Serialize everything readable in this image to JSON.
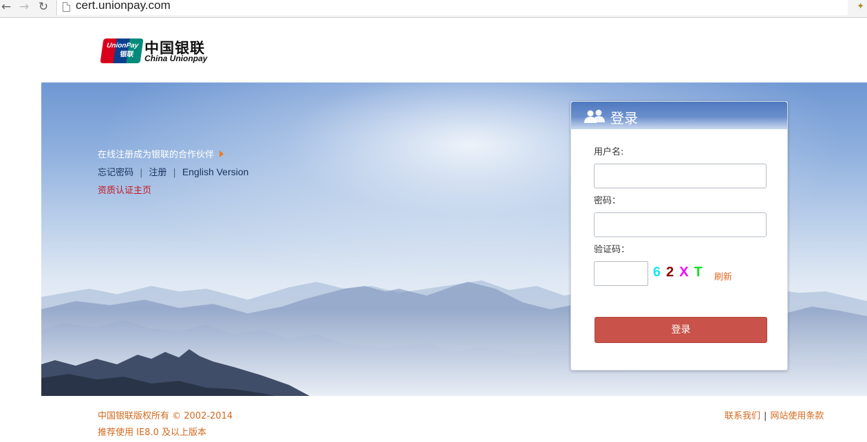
{
  "browser": {
    "url": "cert.unionpay.com",
    "nav_back_icon": "←",
    "nav_forward_icon": "→",
    "nav_reload_icon": "↻"
  },
  "logo": {
    "card_text_top": "UnionPay",
    "card_text_bottom": "银联",
    "name_cn": "中国银联",
    "name_en": "China Unionpay"
  },
  "hero": {
    "partner_link": "在线注册成为银联的合作伙伴",
    "links": [
      "忘记密码",
      "注册",
      "English Version"
    ],
    "separator": "|",
    "cert_home": "资质认证主页"
  },
  "login": {
    "title": "登录",
    "username_label": "用户名:",
    "password_label": "密码：",
    "captcha_label": "验证码：",
    "captcha_chars": [
      {
        "char": "6",
        "color": "#19e6f0"
      },
      {
        "char": "2",
        "color": "#8b0000"
      },
      {
        "char": "X",
        "color": "#ff00ff"
      },
      {
        "char": "T",
        "color": "#11e21f"
      }
    ],
    "refresh_label": "刷新",
    "submit_label": "登录"
  },
  "footer": {
    "copyright": "中国银联版权所有 © 2002-2014",
    "recommend": "推荐使用 IE8.0 及以上版本",
    "contact": "联系我们",
    "separator": "|",
    "terms": "网站使用条款"
  },
  "colors": {
    "accent_orange": "#d2691e",
    "login_button": "#c9534a",
    "link_red": "#c81624"
  }
}
